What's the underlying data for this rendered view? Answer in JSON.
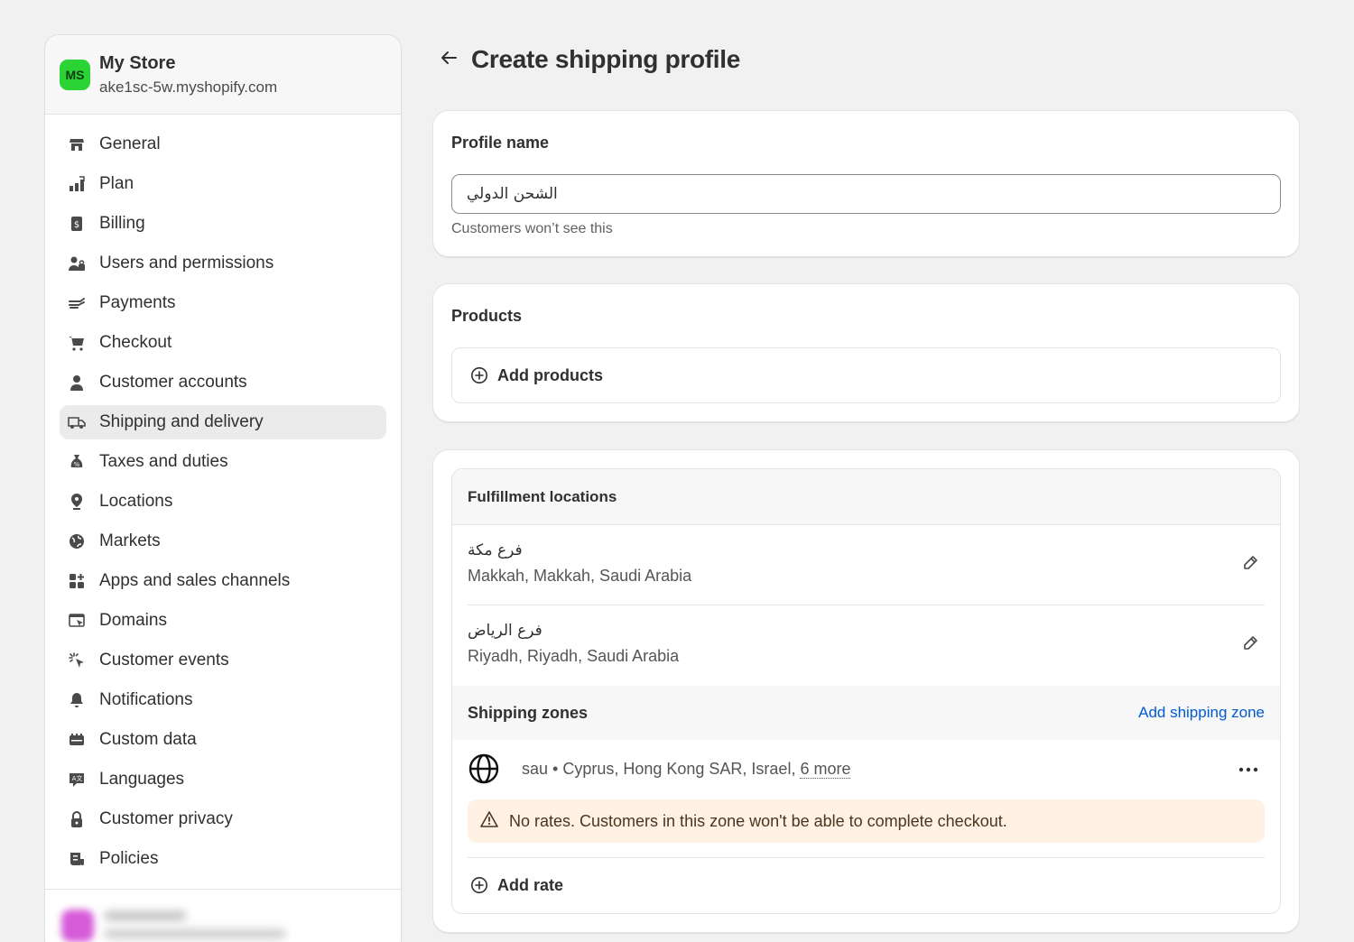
{
  "store": {
    "avatar_initials": "MS",
    "name": "My Store",
    "domain": "ake1sc-5w.myshopify.com"
  },
  "sidebar": {
    "items": [
      {
        "label": "General",
        "icon": "store-icon"
      },
      {
        "label": "Plan",
        "icon": "plan-icon"
      },
      {
        "label": "Billing",
        "icon": "billing-icon"
      },
      {
        "label": "Users and permissions",
        "icon": "users-icon"
      },
      {
        "label": "Payments",
        "icon": "payments-icon"
      },
      {
        "label": "Checkout",
        "icon": "cart-icon"
      },
      {
        "label": "Customer accounts",
        "icon": "person-icon"
      },
      {
        "label": "Shipping and delivery",
        "icon": "truck-icon",
        "active": true
      },
      {
        "label": "Taxes and duties",
        "icon": "tax-icon"
      },
      {
        "label": "Locations",
        "icon": "location-icon"
      },
      {
        "label": "Markets",
        "icon": "globe-icon"
      },
      {
        "label": "Apps and sales channels",
        "icon": "apps-icon"
      },
      {
        "label": "Domains",
        "icon": "domains-icon"
      },
      {
        "label": "Customer events",
        "icon": "cursor-click-icon"
      },
      {
        "label": "Notifications",
        "icon": "bell-icon"
      },
      {
        "label": "Custom data",
        "icon": "custom-data-icon"
      },
      {
        "label": "Languages",
        "icon": "language-icon"
      },
      {
        "label": "Customer privacy",
        "icon": "lock-icon"
      },
      {
        "label": "Policies",
        "icon": "policies-icon"
      }
    ]
  },
  "page": {
    "title": "Create shipping profile",
    "back_icon": "arrow-left-icon"
  },
  "profile_name": {
    "title": "Profile name",
    "value": "الشحن الدولي",
    "help": "Customers won’t see this"
  },
  "products": {
    "title": "Products",
    "add_label": "Add products"
  },
  "fulfillment": {
    "title": "Fulfillment locations",
    "locations": [
      {
        "name": "فرع مكة",
        "address": "Makkah, Makkah, Saudi Arabia"
      },
      {
        "name": "فرع الرياض",
        "address": "Riyadh, Riyadh, Saudi Arabia"
      }
    ]
  },
  "zones": {
    "title": "Shipping zones",
    "add_link": "Add shipping zone",
    "zone": {
      "text": "sau • Cyprus, Hong Kong SAR, Israel,",
      "more": "6 more"
    },
    "warning": "No rates. Customers in this zone won't be able to complete checkout.",
    "add_rate": "Add rate"
  },
  "colors": {
    "accent_link": "#005bd3",
    "avatar": "#2bd434",
    "warning_bg": "#fff1e3"
  }
}
